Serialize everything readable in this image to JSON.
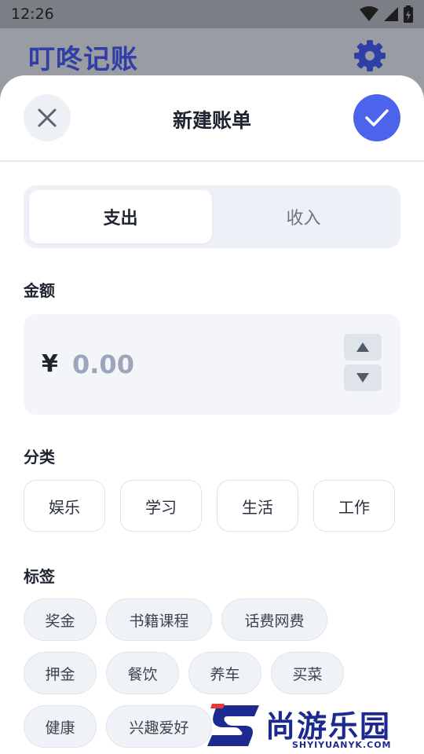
{
  "status_bar": {
    "time": "12:26"
  },
  "app": {
    "title": "叮咚记账"
  },
  "sheet": {
    "title": "新建账单",
    "type_options": [
      {
        "label": "支出",
        "selected": true
      },
      {
        "label": "收入",
        "selected": false
      }
    ],
    "amount": {
      "label": "金额",
      "currency": "¥",
      "value": "",
      "placeholder": "0.00"
    },
    "category": {
      "label": "分类",
      "items": [
        "娱乐",
        "学习",
        "生活",
        "工作"
      ]
    },
    "tags": {
      "label": "标签",
      "items": [
        "奖金",
        "书籍课程",
        "话费网费",
        "押金",
        "餐饮",
        "养车",
        "买菜",
        "健康",
        "兴趣爱好"
      ]
    }
  },
  "watermark": {
    "brand": "尚游乐园",
    "domain": "SHYIYUANYK.COM"
  },
  "colors": {
    "accent": "#4c63ec",
    "title_blue": "#2f3fa6",
    "chip_border": "#dfe3ea"
  },
  "icons": [
    "wifi-icon",
    "signal-icon",
    "battery-icon",
    "gear-icon",
    "close-icon",
    "check-icon",
    "arrow-up-icon",
    "arrow-down-icon"
  ]
}
